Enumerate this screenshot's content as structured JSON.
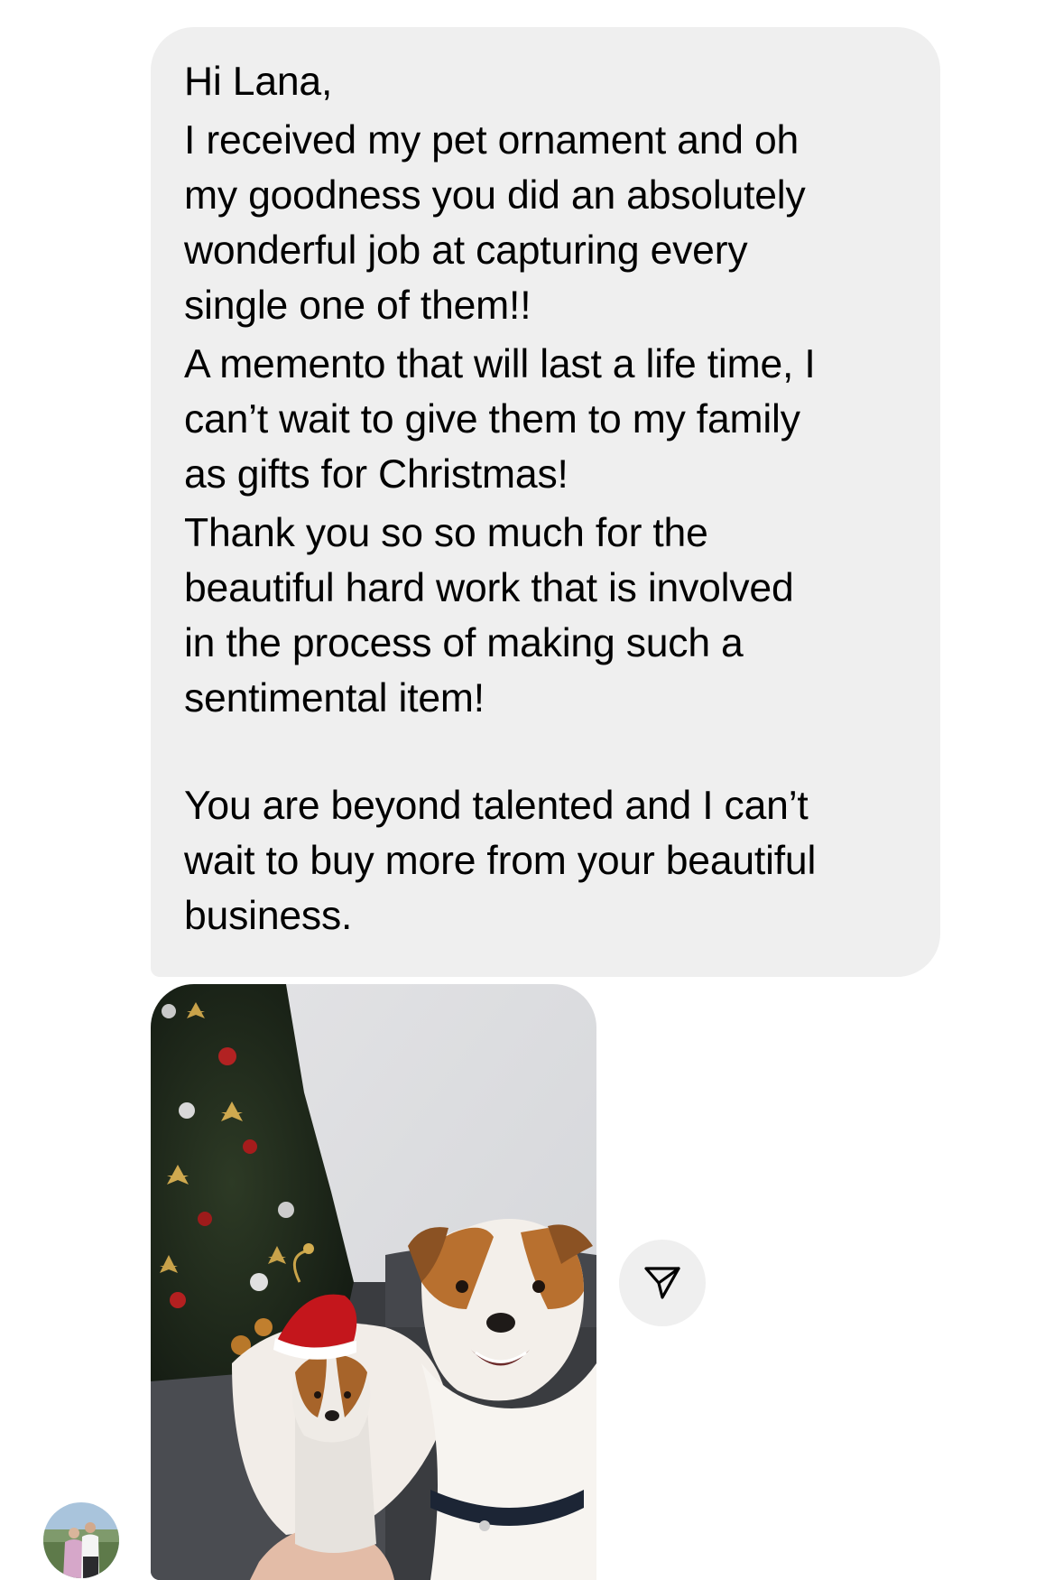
{
  "message": {
    "paragraphs": [
      "Hi Lana,",
      "I received my pet ornament and oh\nmy goodness you did an absolutely\nwonderful job at capturing every\nsingle one of them!!",
      "A memento that will last a life time, I\ncan’t wait to give them to my family\nas gifts for Christmas!",
      "Thank you so so much for the\nbeautiful hard work that is involved\nin the process of making such a\nsentimental item!",
      "You are beyond talented and I can’t\nwait to buy more from your beautiful\nbusiness."
    ]
  },
  "photo": {
    "icon": "dog-with-christmas-ornament-photo"
  },
  "share": {
    "icon": "paper-plane-icon"
  },
  "sender": {
    "icon": "avatar-photo"
  },
  "colors": {
    "bubble": "#efefef",
    "text": "#000000",
    "background": "#ffffff"
  }
}
